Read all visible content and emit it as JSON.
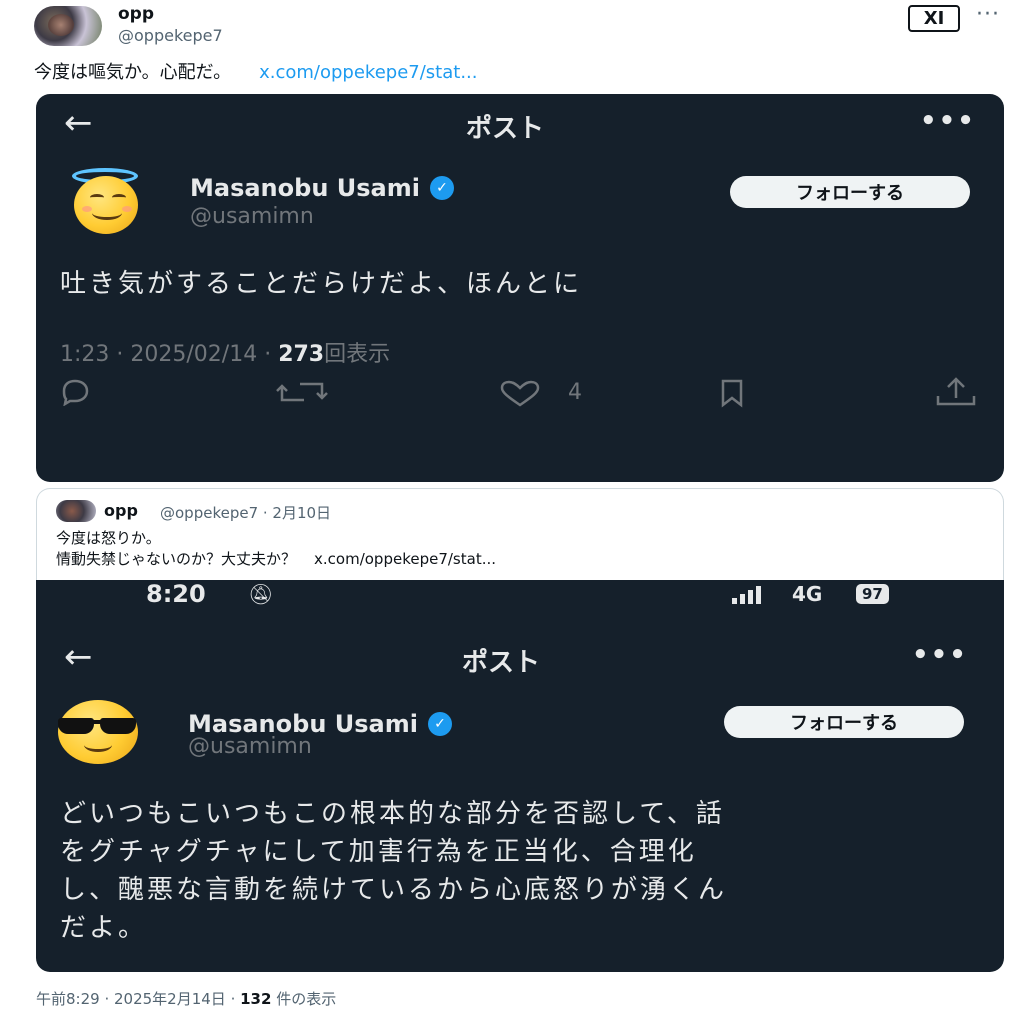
{
  "outer": {
    "name": "opp",
    "handle": "@oppekepe7",
    "logo": "XI",
    "more": "···",
    "text": "今度は嘔気か。心配だ。",
    "link": "x.com/oppekepe7/stat..."
  },
  "shot1": {
    "nav_title": "ポスト",
    "name": "Masanobu Usami",
    "handle": "@usamimn",
    "follow": "フォローする",
    "body": "吐き気がすることだらけだよ、ほんとに",
    "time": "1:23",
    "date": "2025/02/14",
    "views": "273",
    "views_label": "回表示",
    "likes": "4"
  },
  "quote": {
    "name": "opp",
    "handle_date": "@oppekepe7 · 2月10日",
    "line1": "今度は怒りか。",
    "line2": "情動失禁じゃないのか？大丈夫か？",
    "link": "x.com/oppekepe7/stat..."
  },
  "shot2": {
    "status_time": "8:20",
    "network": "4G",
    "battery": "97",
    "nav_title": "ポスト",
    "name": "Masanobu Usami",
    "handle": "@usamimn",
    "follow": "フォローする",
    "body_line1": "どいつもこいつもこの根本的な部分を否認して、話",
    "body_line2": "をグチャグチャにして加害行為を正当化、合理化",
    "body_line3": "し、醜悪な言動を続けているから心底怒りが湧くん",
    "body_line4": "だよ。"
  },
  "footer": {
    "time": "午前8:29",
    "date": "2025年2月14日",
    "views": "132",
    "views_label": "件の表示"
  },
  "icons": {
    "reply": "reply-icon",
    "retweet": "retweet-icon",
    "like": "heart-icon",
    "bookmark": "bookmark-icon",
    "share": "share-icon"
  },
  "colors": {
    "dark_bg": "#15202b",
    "accent": "#1d9bf0",
    "muted": "#71767b"
  }
}
